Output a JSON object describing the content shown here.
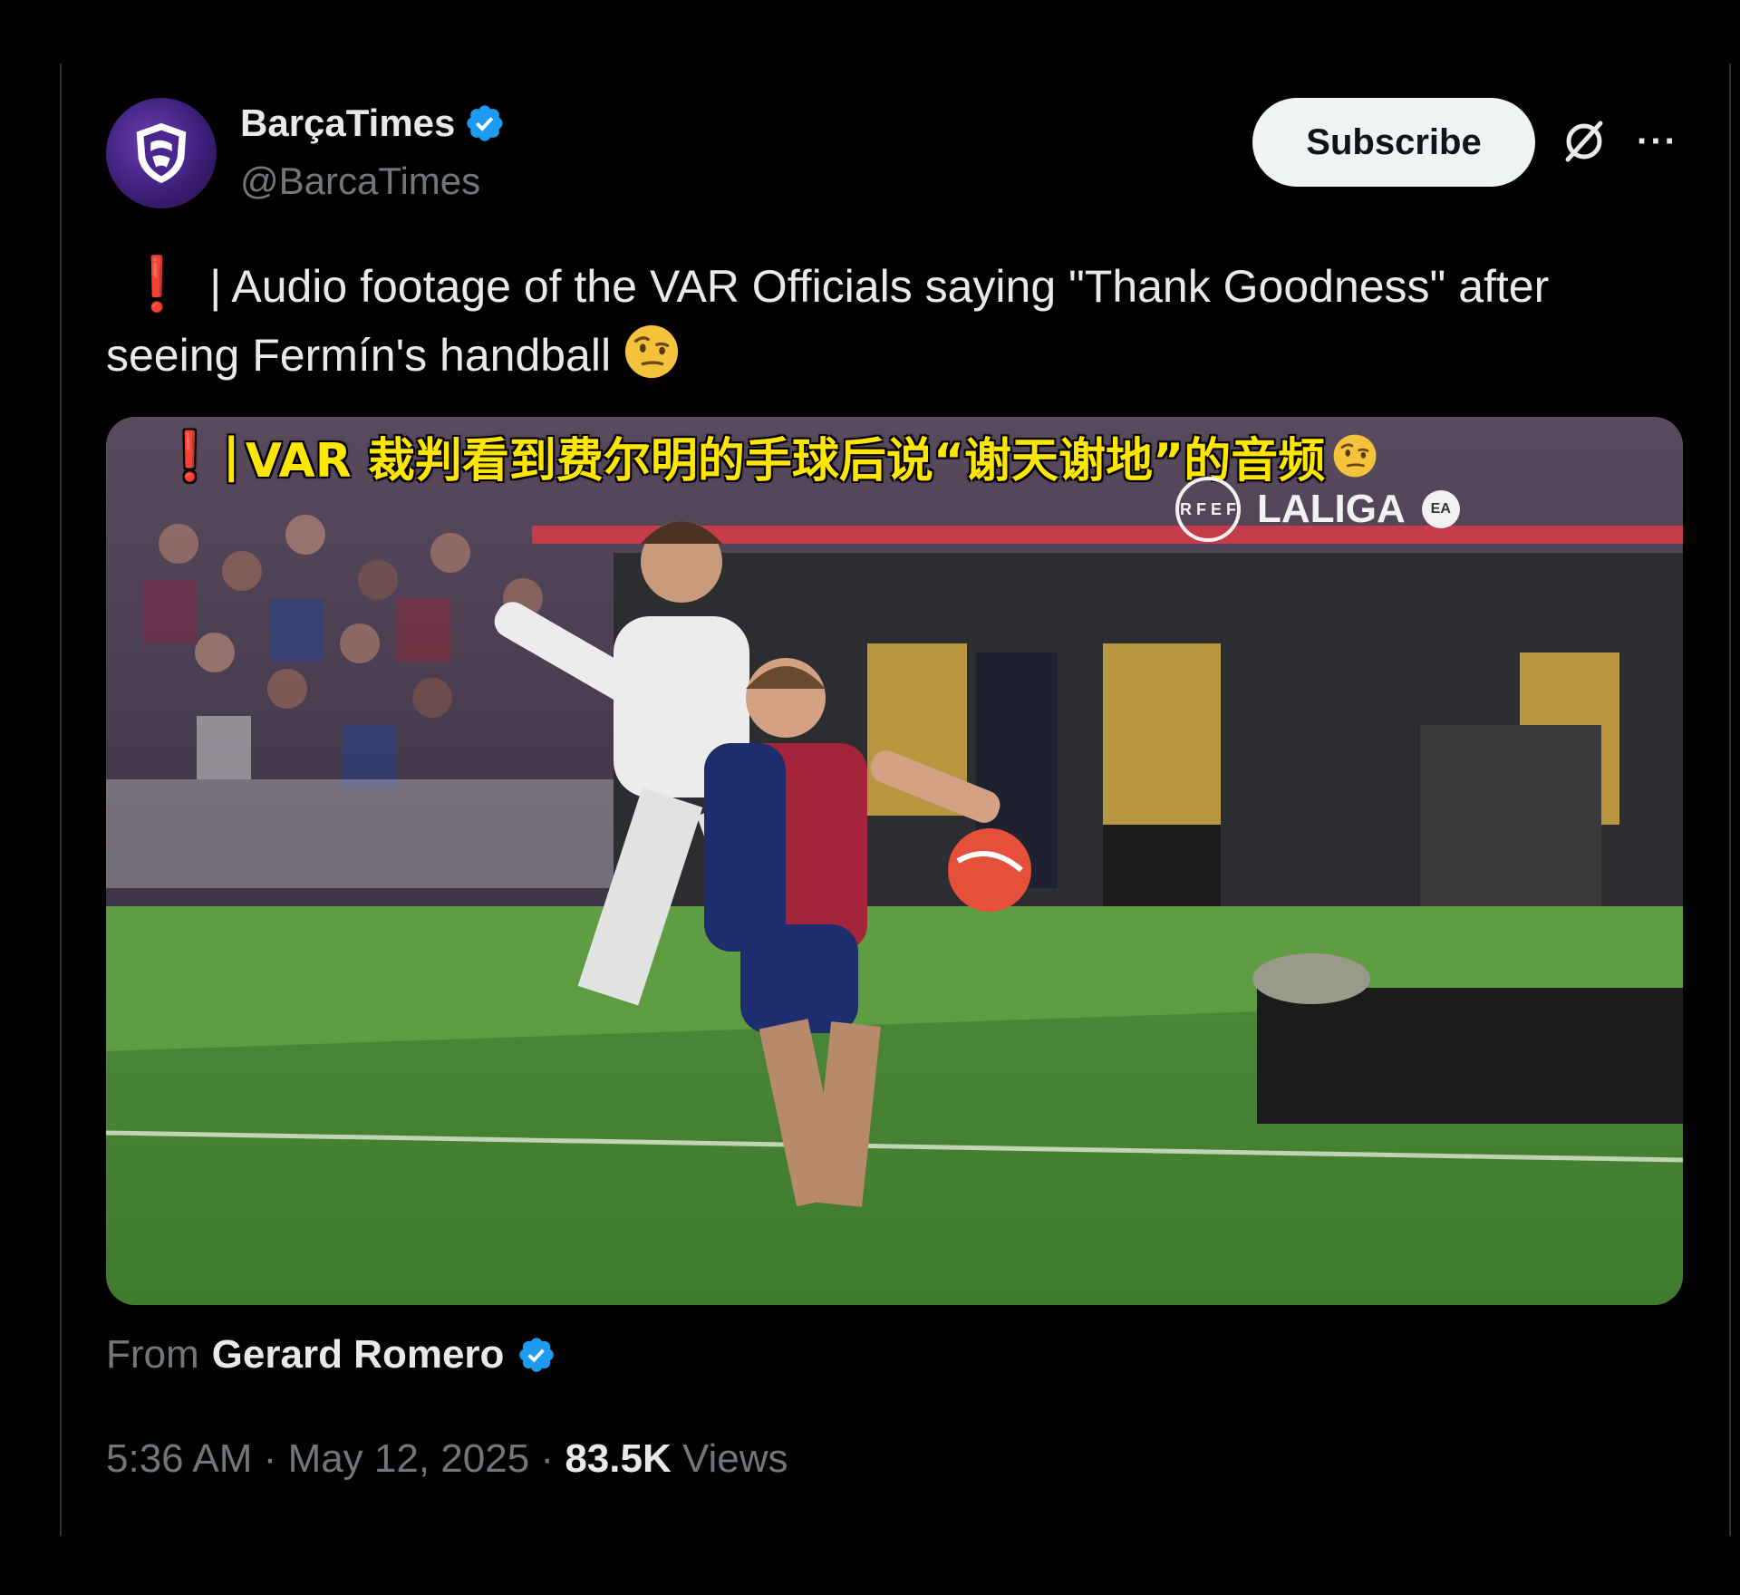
{
  "author": {
    "display_name": "BarçaTimes",
    "handle": "@BarcaTimes",
    "verified": true
  },
  "header": {
    "subscribe_label": "Subscribe",
    "grok_icon": "grok-icon",
    "more_icon": "more-icon"
  },
  "tweet": {
    "emoji_alert": "❗",
    "text": "| Audio footage of the VAR Officials saying \"Thank Goodness\" after seeing Fermín's handball",
    "emoji_end": "face-with-raised-eyebrow"
  },
  "media": {
    "caption_excl": "❗",
    "caption_bar": "|",
    "caption_text": "VAR 裁判看到费尔明的手球后说“谢天谢地”的音频",
    "broadcast_logo": "LALIGA",
    "rfef_label": "R F E F",
    "ea_label": "EA"
  },
  "from": {
    "prefix": "From",
    "name": "Gerard Romero",
    "verified": true
  },
  "meta": {
    "time": "5:36 AM",
    "date": "May 12, 2025",
    "views_count": "83.5K",
    "views_label": "Views"
  },
  "colors": {
    "background": "#000000",
    "verified_blue": "#1d9bf0",
    "alert_red": "#e2232e",
    "caption_yellow": "#ffe600"
  }
}
